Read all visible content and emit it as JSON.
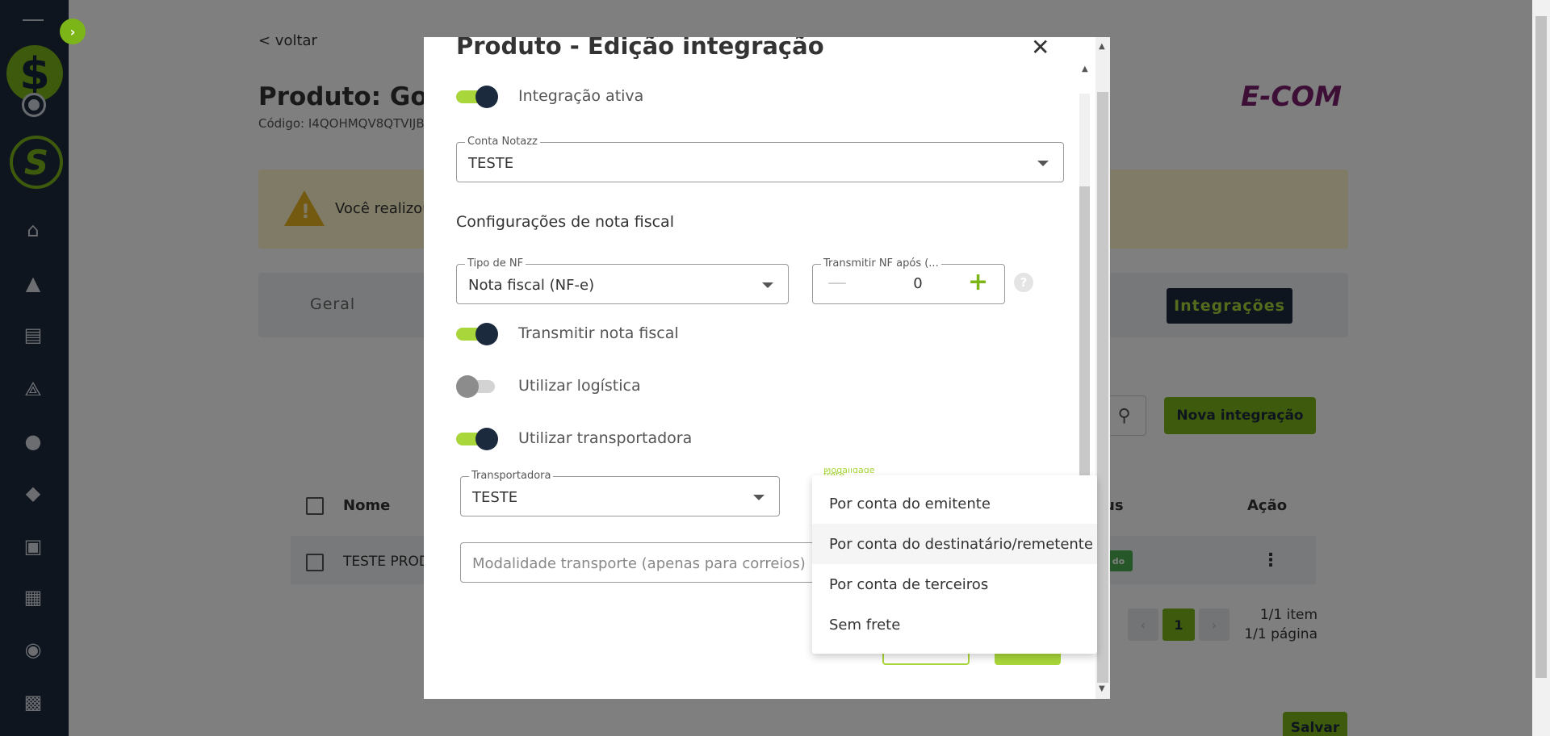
{
  "sidebar": {
    "icons": [
      "home-icon",
      "bag-icon",
      "presentation-chart-icon",
      "network-icon",
      "users-icon",
      "diamond-icon",
      "money-icon",
      "apps-grid-icon",
      "account-icon",
      "gift-icon"
    ]
  },
  "page": {
    "back_link": "< voltar",
    "product_title": "Produto: Gota",
    "product_code": "Código: I4QOHMQV8QTVIJB",
    "brand_logo": "E-COM",
    "warning_text": "Você realizou",
    "tabs": {
      "geral": "Geral",
      "integracoes": "Integrações"
    },
    "nova_integracao": "Nova integração",
    "table": {
      "headers": {
        "nome": "Nome",
        "status": "us",
        "acao": "Ação"
      },
      "rows": [
        {
          "nome": "TESTE PROD",
          "status": "do"
        }
      ]
    },
    "pagination": {
      "current": "1",
      "items": "1/1 item",
      "pages": "1/1 página"
    },
    "salvar": "Salvar"
  },
  "modal": {
    "title": "Produto - Edição integração",
    "toggles": {
      "integracao_ativa": {
        "label": "Integração ativa",
        "on": true
      },
      "transmitir_nf": {
        "label": "Transmitir nota fiscal",
        "on": true
      },
      "utilizar_logistica": {
        "label": "Utilizar logística",
        "on": false
      },
      "utilizar_transportadora": {
        "label": "Utilizar transportadora",
        "on": true
      }
    },
    "conta_notazz": {
      "label": "Conta Notazz",
      "value": "TESTE"
    },
    "section_heading": "Configurações de nota fiscal",
    "tipo_nf": {
      "label": "Tipo de NF",
      "value": "Nota fiscal (NF-e)"
    },
    "transmitir_apos": {
      "label": "Transmitir NF após (...",
      "value": "0"
    },
    "transportadora": {
      "label": "Transportadora",
      "value": "TESTE"
    },
    "modalidade_frete_label": "Modalidade frete",
    "modalidade_transporte_placeholder": "Modalidade transporte (apenas para correios)"
  },
  "dropdown": {
    "options": [
      "Por conta do emitente",
      "Por conta do destinatário/remetente",
      "Por conta de terceiros",
      "Sem frete"
    ],
    "hovered_index": 1
  },
  "colors": {
    "sidebar": "#1c2a3e",
    "accent_green": "#7cb518",
    "toggle_green": "#a9d63a",
    "brand_purple": "#7b1f6f"
  }
}
